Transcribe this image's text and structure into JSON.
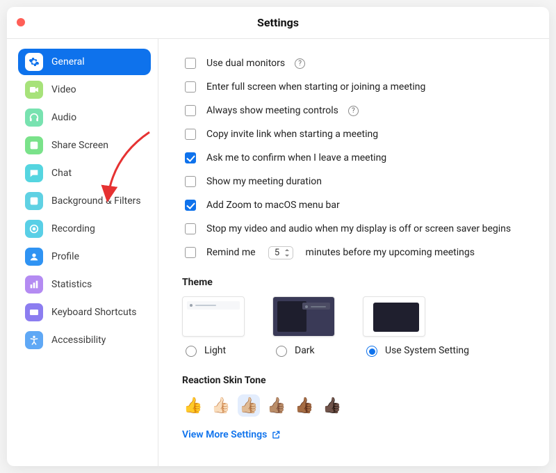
{
  "window": {
    "title": "Settings"
  },
  "sidebar": {
    "items": [
      {
        "label": "General",
        "icon": "gear-icon",
        "color": "#0e72ec",
        "selected": true
      },
      {
        "label": "Video",
        "icon": "video-icon",
        "color": "#a7e27a",
        "selected": false
      },
      {
        "label": "Audio",
        "icon": "headphones-icon",
        "color": "#78e2b0",
        "selected": false
      },
      {
        "label": "Share Screen",
        "icon": "share-icon",
        "color": "#7ae28a",
        "selected": false
      },
      {
        "label": "Chat",
        "icon": "chat-icon",
        "color": "#55d5e0",
        "selected": false
      },
      {
        "label": "Background & Filters",
        "icon": "background-icon",
        "color": "#5fd1e3",
        "selected": false
      },
      {
        "label": "Recording",
        "icon": "record-icon",
        "color": "#59cfe6",
        "selected": false
      },
      {
        "label": "Profile",
        "icon": "profile-icon",
        "color": "#2f93f3",
        "selected": false
      },
      {
        "label": "Statistics",
        "icon": "stats-icon",
        "color": "#b48bf2",
        "selected": false
      },
      {
        "label": "Keyboard Shortcuts",
        "icon": "keyboard-icon",
        "color": "#8c7df0",
        "selected": false
      },
      {
        "label": "Accessibility",
        "icon": "accessibility-icon",
        "color": "#5fa8f5",
        "selected": false
      }
    ]
  },
  "general": {
    "options": [
      {
        "label": "Use dual monitors",
        "checked": false,
        "help": true
      },
      {
        "label": "Enter full screen when starting or joining a meeting",
        "checked": false,
        "help": false
      },
      {
        "label": "Always show meeting controls",
        "checked": false,
        "help": true
      },
      {
        "label": "Copy invite link when starting a meeting",
        "checked": false,
        "help": false
      },
      {
        "label": "Ask me to confirm when I leave a meeting",
        "checked": true,
        "help": false
      },
      {
        "label": "Show my meeting duration",
        "checked": false,
        "help": false
      },
      {
        "label": "Add Zoom to macOS menu bar",
        "checked": true,
        "help": false
      },
      {
        "label": "Stop my video and audio when my display is off or screen saver begins",
        "checked": false,
        "help": false
      }
    ],
    "remind": {
      "prefix": "Remind me",
      "value": "5",
      "suffix": "minutes before my upcoming meetings",
      "checked": false
    },
    "theme_heading": "Theme",
    "themes": [
      {
        "id": "light",
        "label": "Light",
        "selected": false
      },
      {
        "id": "dark",
        "label": "Dark",
        "selected": false
      },
      {
        "id": "system",
        "label": "Use System Setting",
        "selected": true
      }
    ],
    "skin_heading": "Reaction Skin Tone",
    "skin_tones": [
      "👍",
      "👍🏻",
      "👍🏼",
      "👍🏽",
      "👍🏾",
      "👍🏿"
    ],
    "skin_selected_index": 2,
    "view_more": "View More Settings"
  }
}
